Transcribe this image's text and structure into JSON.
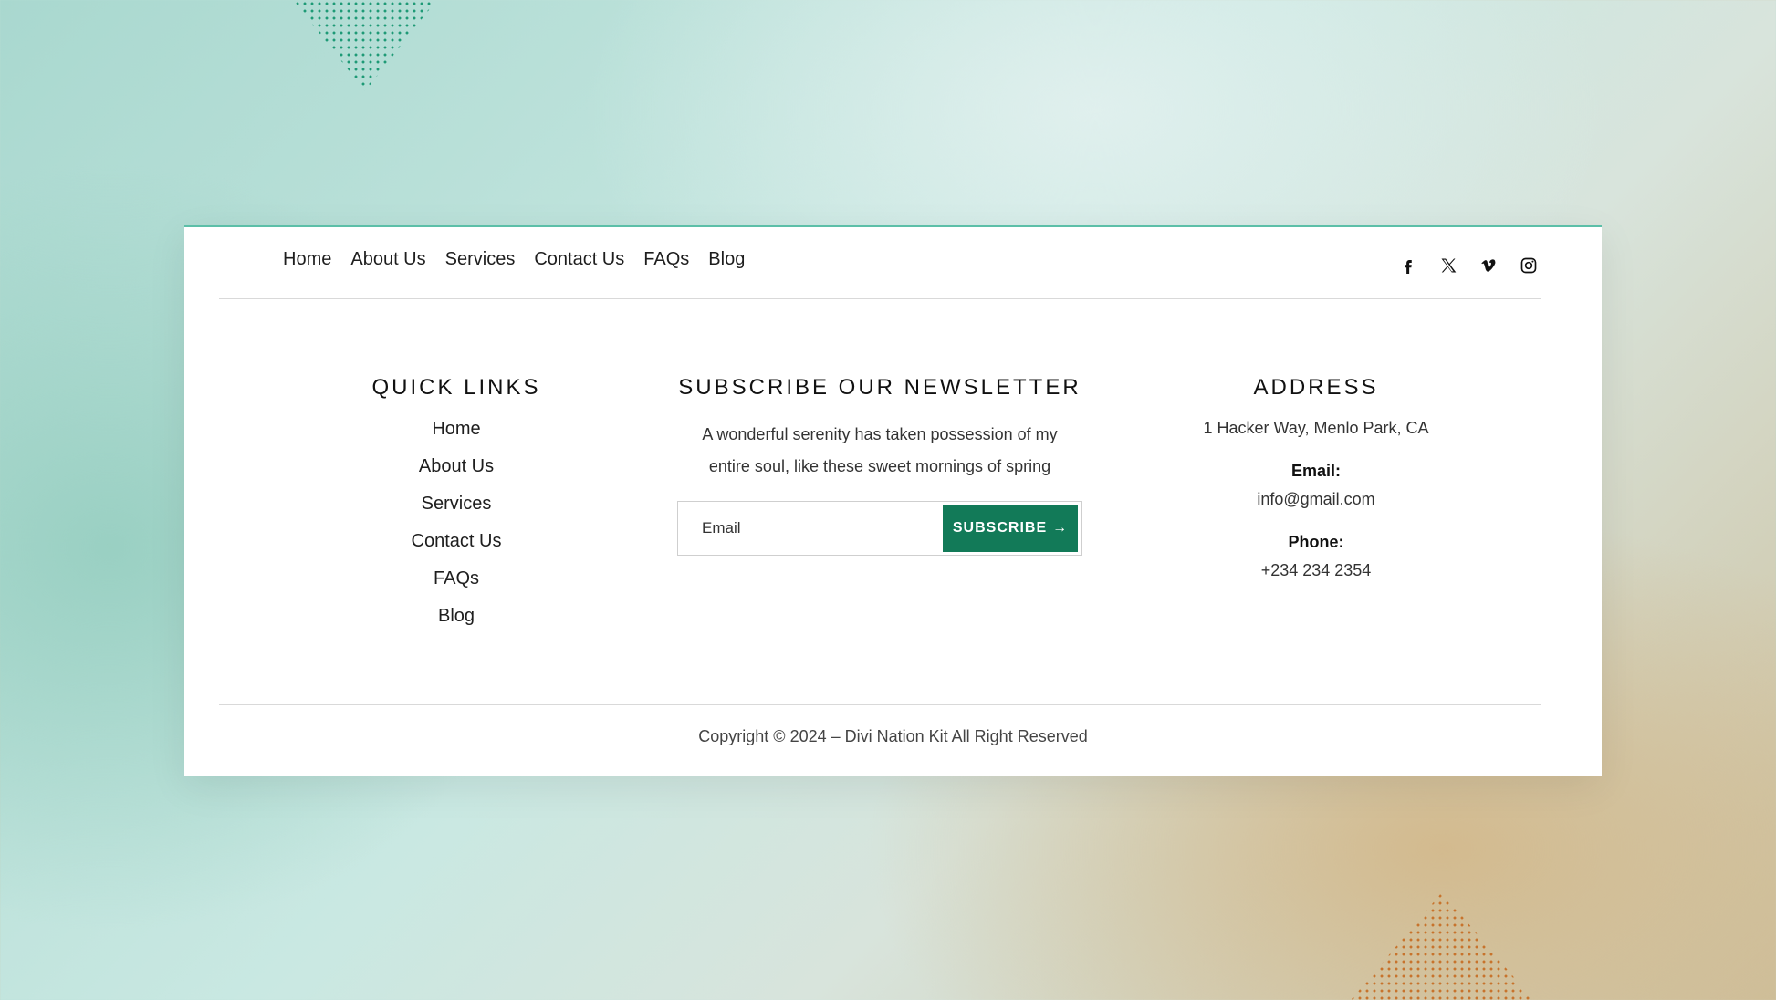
{
  "nav": {
    "items": [
      "Home",
      "About Us",
      "Services",
      "Contact Us",
      "FAQs",
      "Blog"
    ]
  },
  "social": {
    "icons": [
      "facebook-icon",
      "x-icon",
      "vimeo-icon",
      "instagram-icon"
    ]
  },
  "quick_links": {
    "title": "QUICK LINKS",
    "items": [
      "Home",
      "About Us",
      "Services",
      "Contact Us",
      "FAQs",
      "Blog"
    ]
  },
  "newsletter": {
    "title": "SUBSCRIBE OUR NEWSLETTER",
    "description_line1": "A wonderful serenity has taken possession of my",
    "description_line2": "entire soul, like these sweet mornings of spring",
    "email_placeholder": "Email",
    "button_label": "SUBSCRIBE",
    "button_arrow": "→"
  },
  "address": {
    "title": "ADDRESS",
    "street": "1 Hacker Way, Menlo Park, CA",
    "email_label": "Email:",
    "email_value": "info@gmail.com",
    "phone_label": "Phone:",
    "phone_value": "+234 234 2354"
  },
  "footer": {
    "copyright": "Copyright © 2024 – Divi Nation Kit All Right Reserved"
  },
  "colors": {
    "accent": "#127a58",
    "top_border": "#5cbfa8",
    "dots_top": "#1e9a76",
    "dots_bottom": "#c7732c"
  }
}
